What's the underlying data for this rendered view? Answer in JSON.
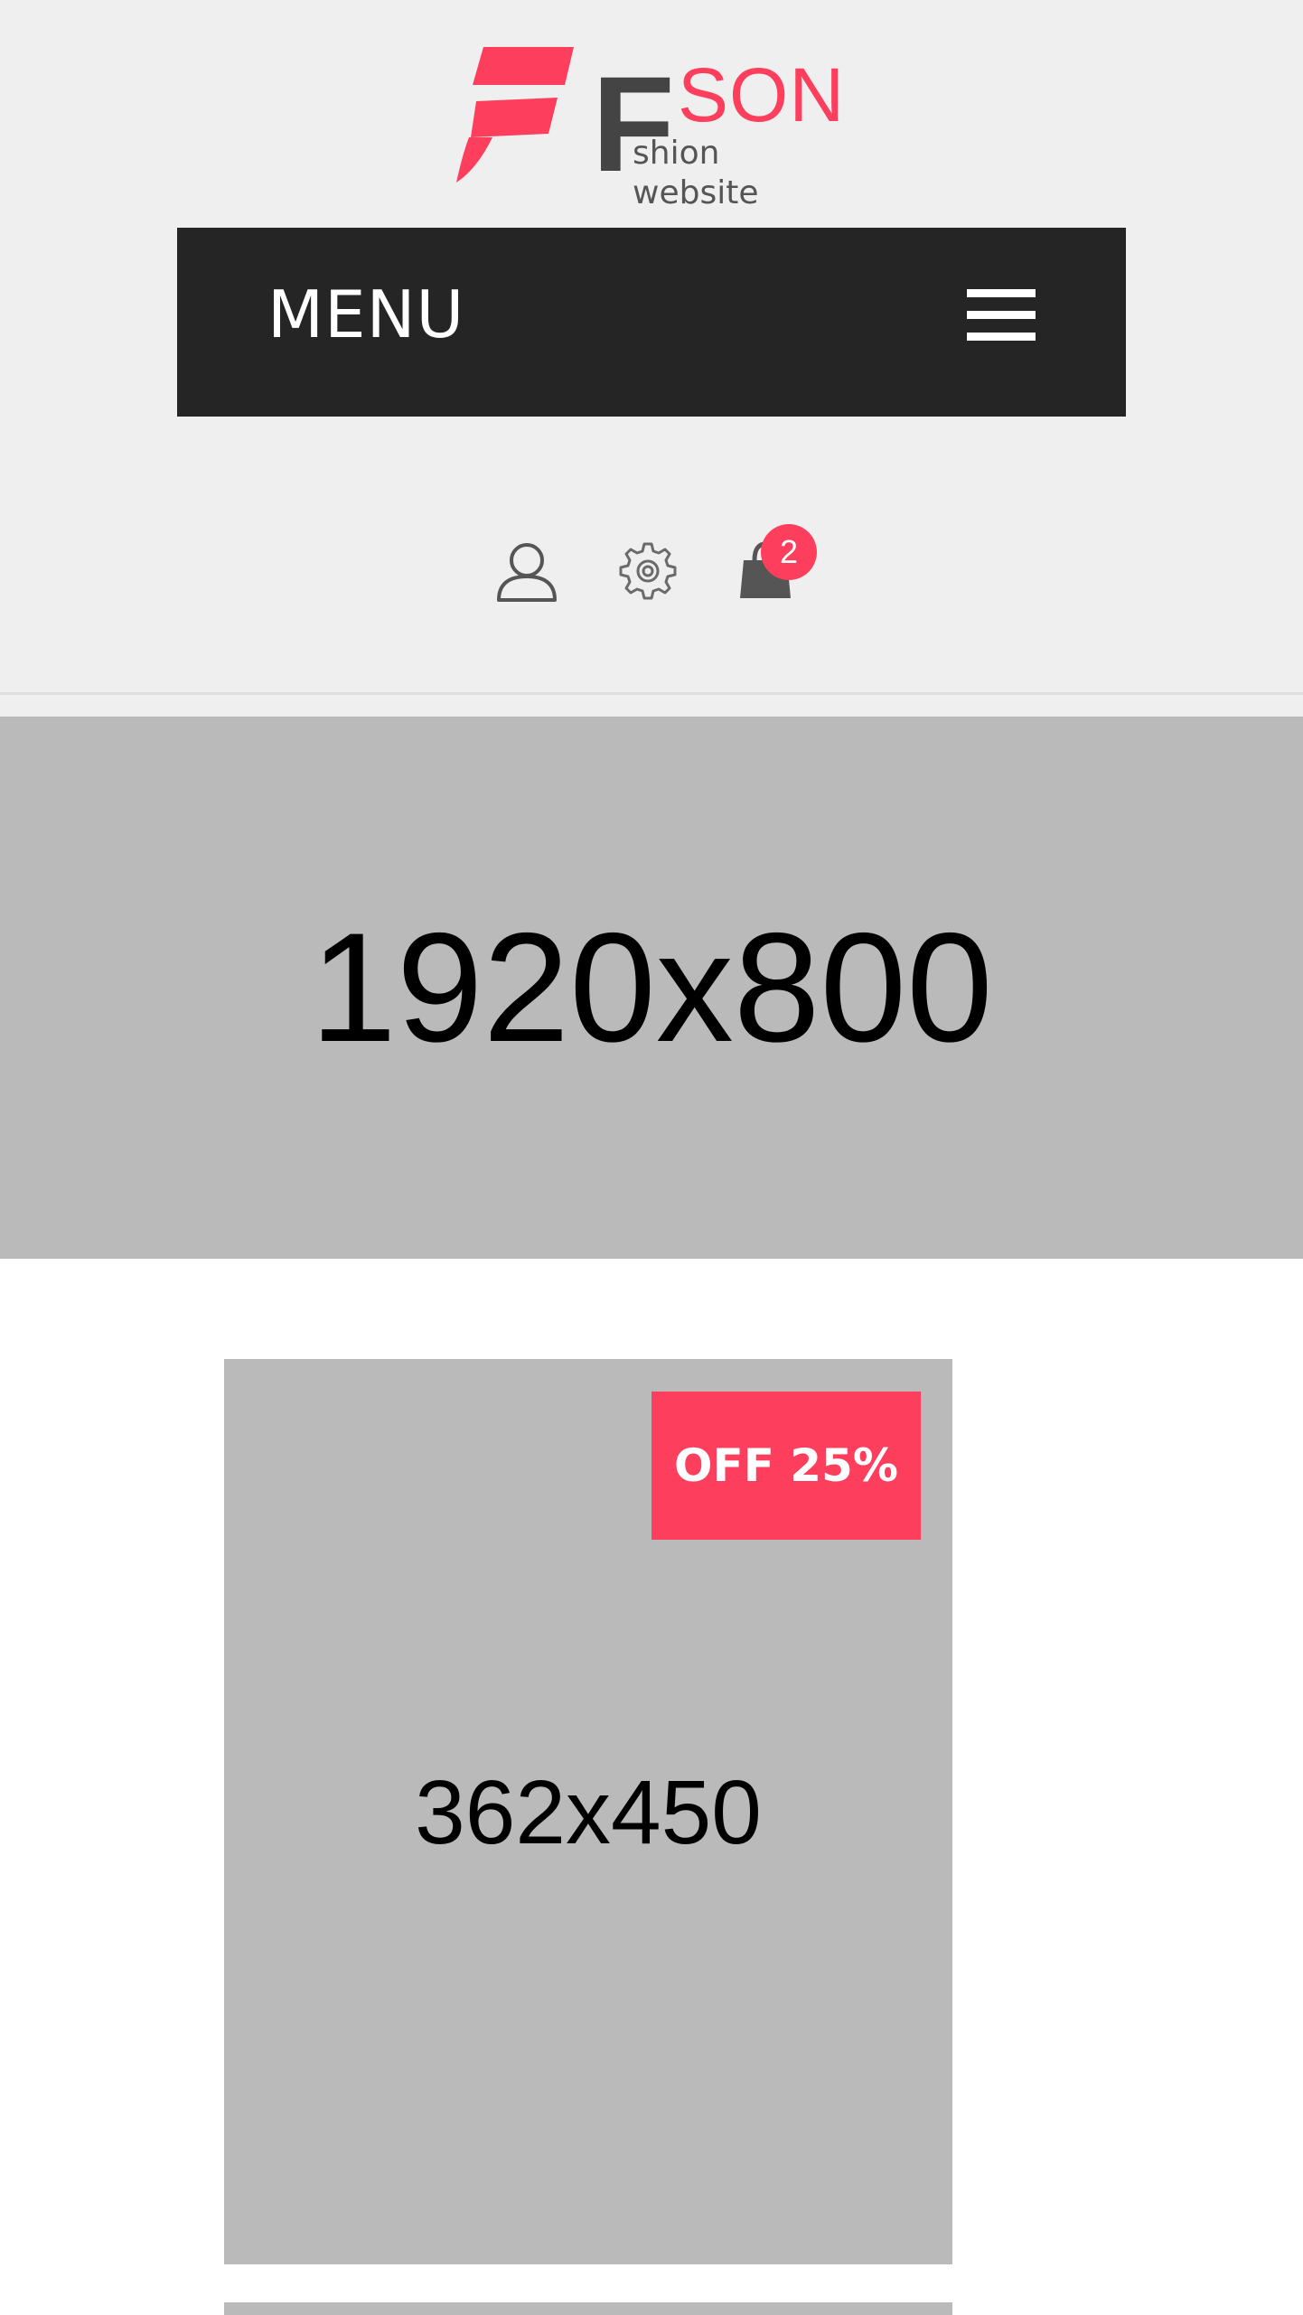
{
  "header": {
    "logo": {
      "brand_letter": "F",
      "brand_suffix": "SON",
      "tagline": "shion website",
      "accent_color": "#fe3e5d",
      "text_color": "#444444"
    },
    "menu": {
      "label": "MENU",
      "toggle_icon": "hamburger-icon"
    },
    "icons": {
      "account": "user-icon",
      "settings": "gear-icon",
      "cart": "shopping-bag-icon"
    },
    "cart_count": "2"
  },
  "hero": {
    "placeholder_text": "1920x800"
  },
  "products": [
    {
      "placeholder_text": "362x450",
      "badge": "OFF 25%"
    }
  ],
  "colors": {
    "accent": "#fe3e5d",
    "menu_bar": "#252525",
    "header_bg": "#efefef",
    "placeholder_bg": "#bababa"
  }
}
